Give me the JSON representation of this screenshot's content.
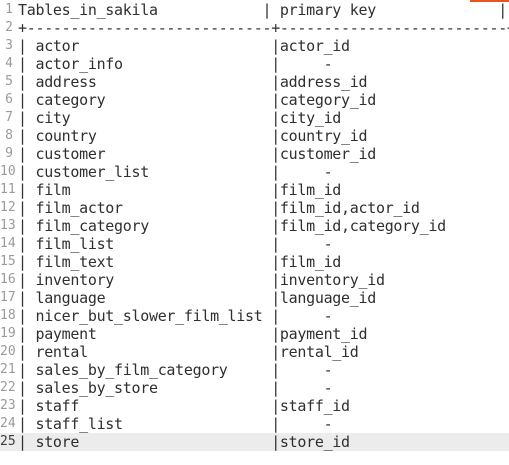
{
  "accent_color": "#e95420",
  "current_line_index": 24,
  "lines": [
    {
      "number": "1",
      "text": "Tables_in_sakila            | primary key              |"
    },
    {
      "number": "2",
      "text": "+----------------------------+--------------------------+"
    },
    {
      "number": "3",
      "text": "| actor                      |actor_id                  |"
    },
    {
      "number": "4",
      "text": "| actor_info                 |     -                    |"
    },
    {
      "number": "5",
      "text": "| address                    |address_id                |"
    },
    {
      "number": "6",
      "text": "| category                   |category_id               |"
    },
    {
      "number": "7",
      "text": "| city                       |city_id                   |"
    },
    {
      "number": "8",
      "text": "| country                    |country_id                |"
    },
    {
      "number": "9",
      "text": "| customer                   |customer_id               |"
    },
    {
      "number": "10",
      "text": "| customer_list              |     -                    |"
    },
    {
      "number": "11",
      "text": "| film                       |film_id                   |"
    },
    {
      "number": "12",
      "text": "| film_actor                 |film_id,actor_id          |"
    },
    {
      "number": "13",
      "text": "| film_category              |film_id,category_id       |"
    },
    {
      "number": "14",
      "text": "| film_list                  |     -                    |"
    },
    {
      "number": "15",
      "text": "| film_text                  |film_id                   |"
    },
    {
      "number": "16",
      "text": "| inventory                  |inventory_id              |"
    },
    {
      "number": "17",
      "text": "| language                   |language_id               |"
    },
    {
      "number": "18",
      "text": "| nicer_but_slower_film_list |     -                    |"
    },
    {
      "number": "19",
      "text": "| payment                    |payment_id                |"
    },
    {
      "number": "20",
      "text": "| rental                     |rental_id                 |"
    },
    {
      "number": "21",
      "text": "| sales_by_film_category     |     -                    |"
    },
    {
      "number": "22",
      "text": "| sales_by_store             |     -                    |"
    },
    {
      "number": "23",
      "text": "| staff                      |staff_id                  |"
    },
    {
      "number": "24",
      "text": "| staff_list                 |     -                    |"
    },
    {
      "number": "25",
      "text": "| store                      |store_id                  |"
    }
  ]
}
